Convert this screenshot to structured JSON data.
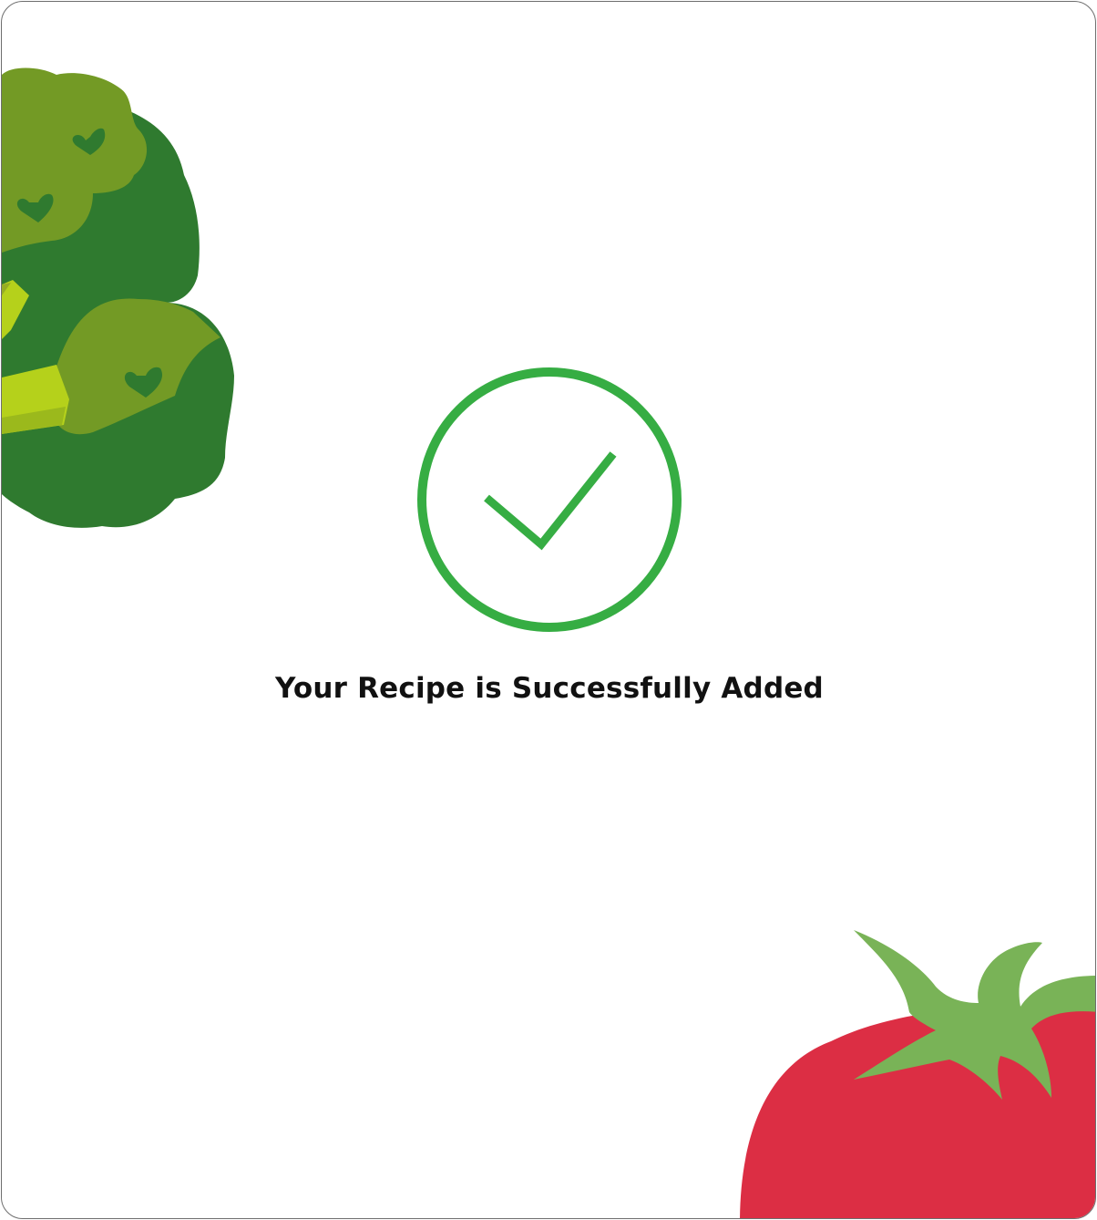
{
  "dialog": {
    "message": "Your Recipe is Successfully Added",
    "status_icon": "check-circle-icon",
    "decorations": [
      "broccoli-illustration",
      "tomato-illustration"
    ]
  },
  "colors": {
    "success_green": "#36ad43",
    "broccoli_dark": "#2f7a2f",
    "broccoli_light": "#739a25",
    "broccoli_stem": "#b5d11b",
    "tomato_red": "#dc2e44",
    "tomato_leaf": "#79b357",
    "text": "#111111",
    "border": "#6e6e6e"
  }
}
